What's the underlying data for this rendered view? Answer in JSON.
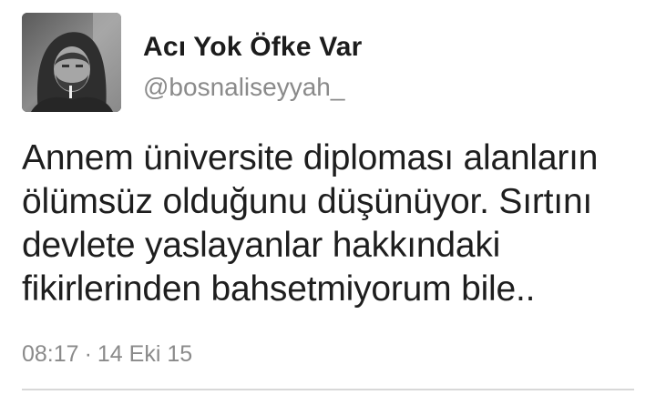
{
  "user": {
    "display_name": "Acı Yok Öfke Var",
    "handle": "@bosnaliseyyah_",
    "avatar_icon": "profile-photo"
  },
  "tweet": {
    "text": "Annem üniversite diploması alanların\nölümsüz olduğunu düşünüyor. Sırtını\ndevlete yaslayanlar hakkındaki\nfikirlerinden bahsetmiyorum bile..",
    "time": "08:17",
    "separator": "·",
    "date": "14 Eki 15"
  },
  "colors": {
    "name": "#1c1c1c",
    "handle": "#8a8a8a",
    "text": "#1e1e1e",
    "meta": "#8a8a8a",
    "divider": "#d8d8d8"
  }
}
